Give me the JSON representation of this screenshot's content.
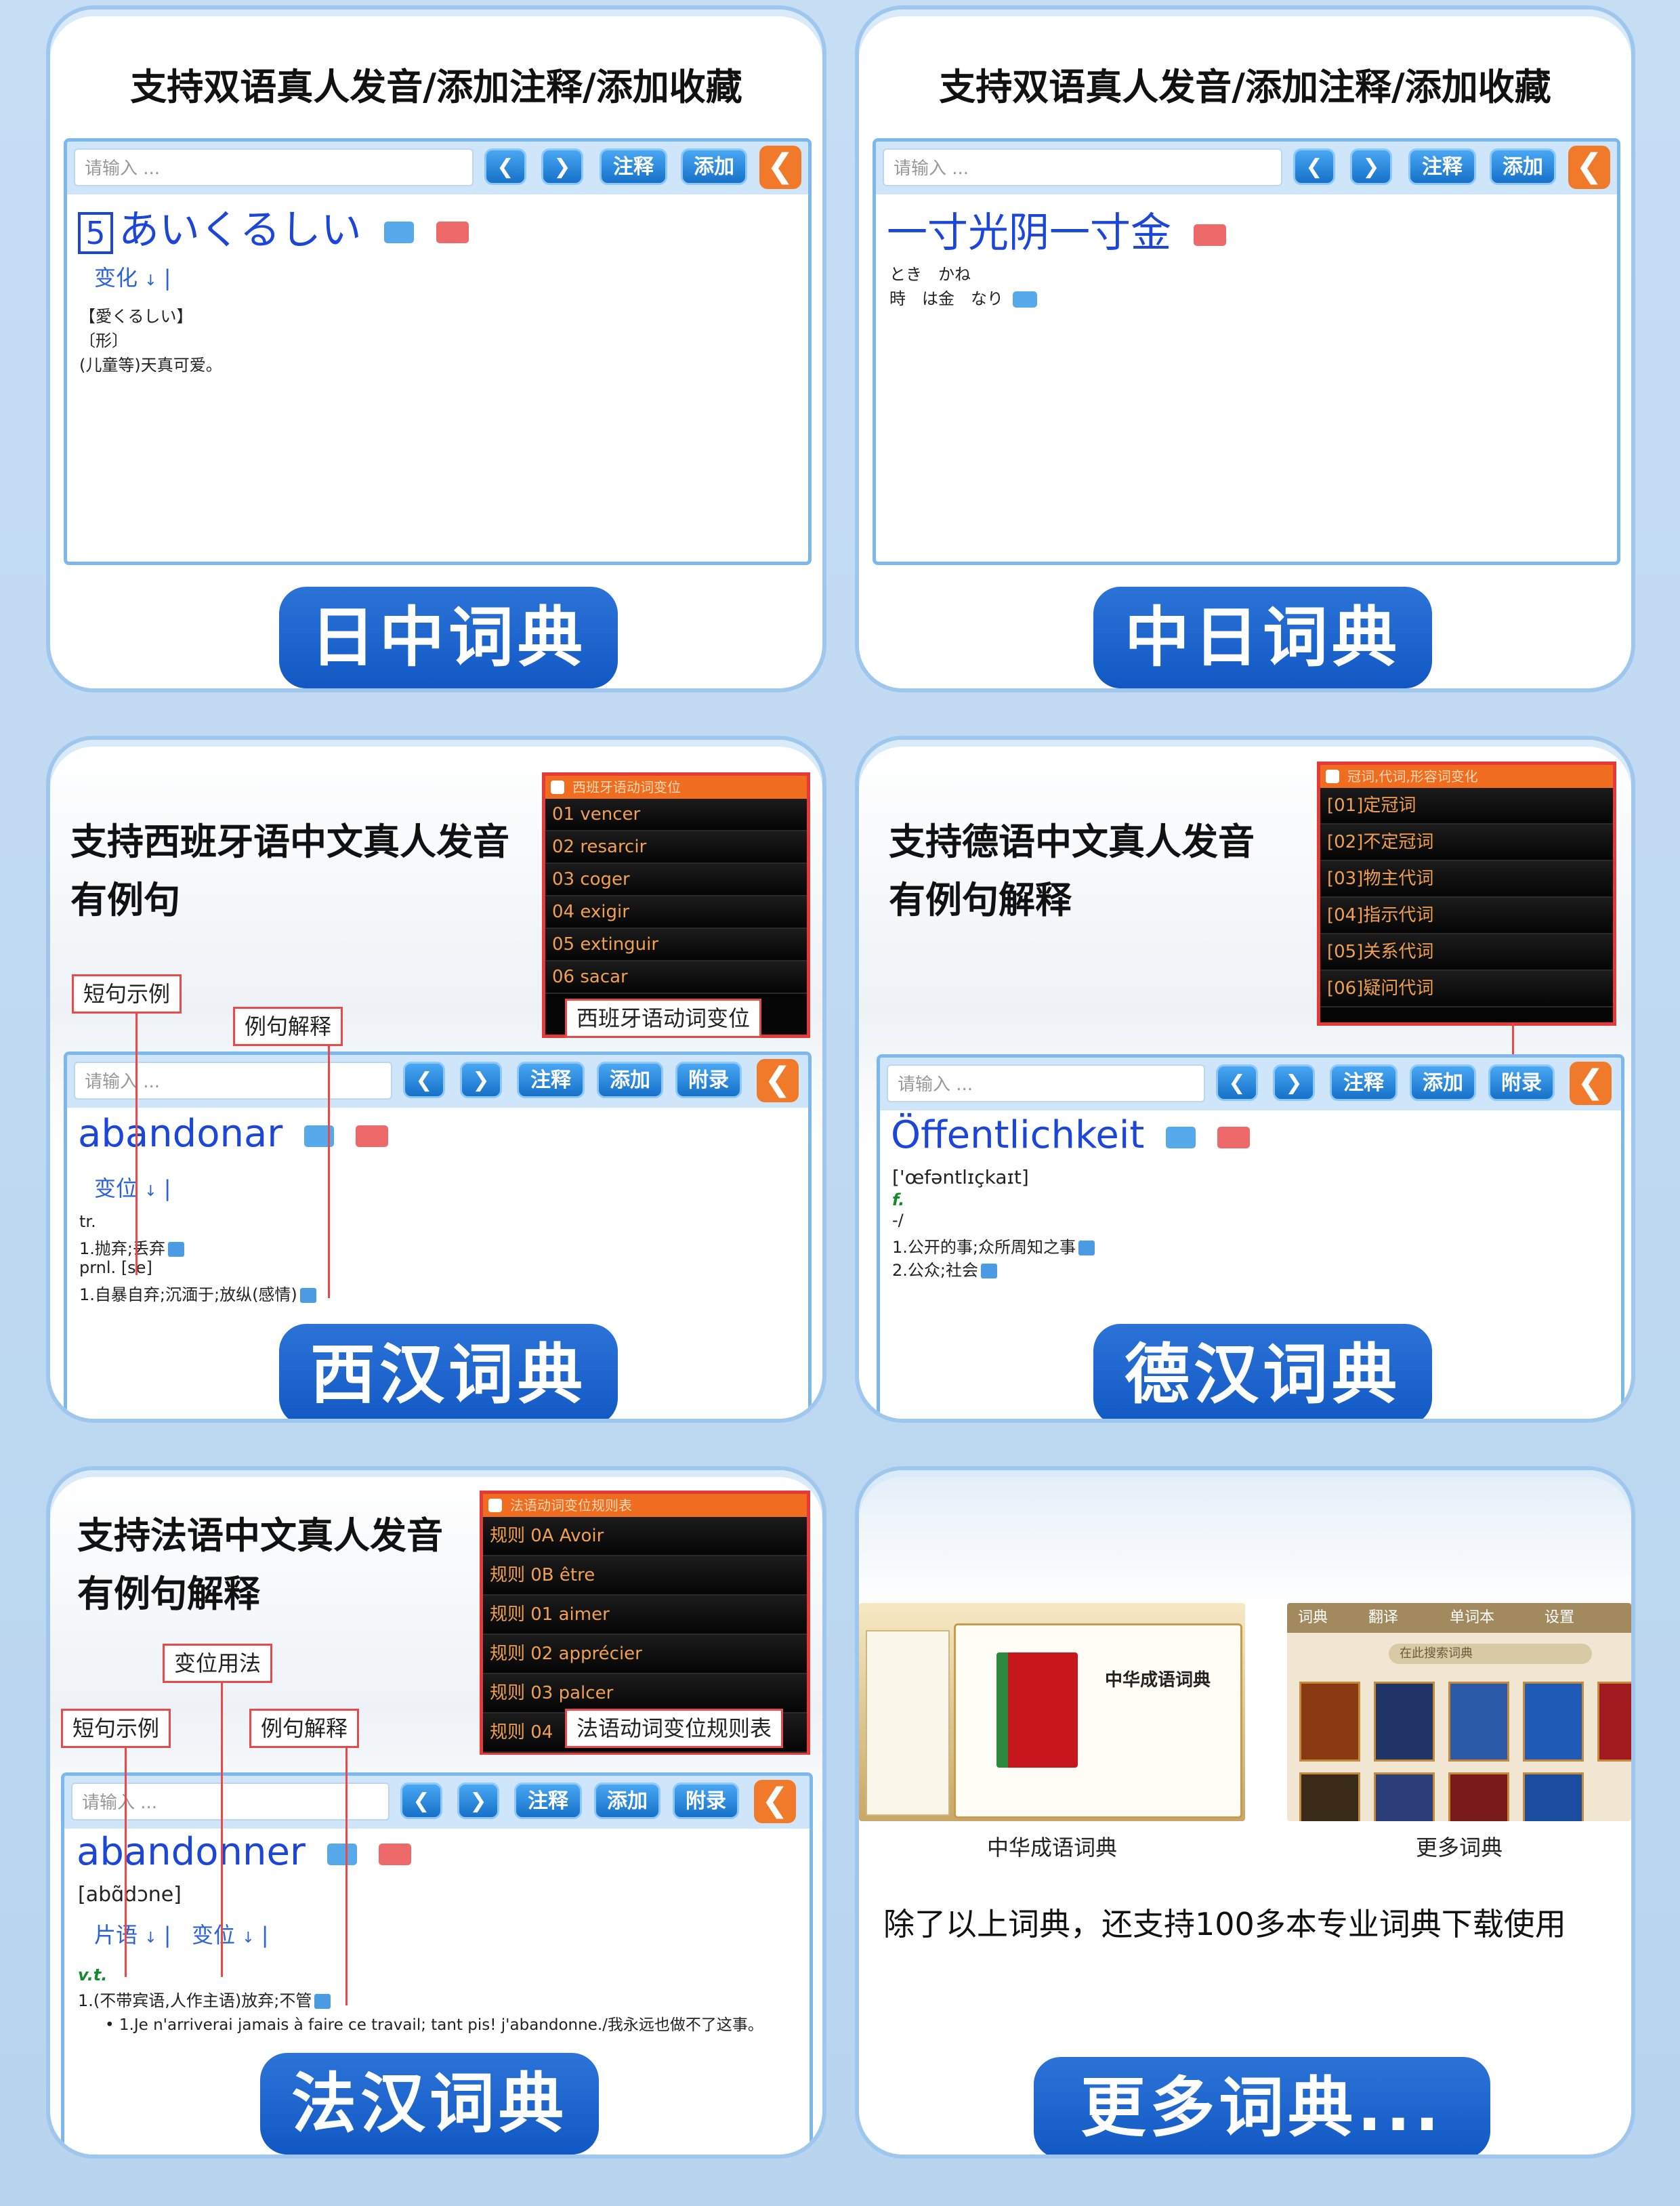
{
  "common": {
    "search_placeholder": "请输入 ...",
    "prev": "❮",
    "next": "❯",
    "note": "注释",
    "add": "添加",
    "appendix": "附录",
    "back": "❮"
  },
  "card1": {
    "heading": "支持双语真人发音/添加注释/添加收藏",
    "entry_num": "5",
    "word": "あいくるしい",
    "variation": "变化",
    "lines": [
      "【愛くるしい】",
      "〔形〕",
      "(儿童等)天真可爱。"
    ],
    "title": "日中词典"
  },
  "card2": {
    "heading": "支持双语真人发音/添加注释/添加收藏",
    "word": "一寸光阴一寸金",
    "furigana": "とき　かね",
    "line": "時　は金　なり",
    "title": "中日词典"
  },
  "card3": {
    "heading_line1": "支持西班牙语中文真人发音",
    "heading_line2": "有例句",
    "callout_short": "短句示例",
    "callout_example": "例句解释",
    "popup_header": "西班牙语动词变位",
    "popup_rows": [
      "01  vencer",
      "02  resarcir",
      "03  coger",
      "04  exigir",
      "05  extinguir",
      "06  sacar"
    ],
    "popup_caption": "西班牙语动词变位",
    "word": "abandonar",
    "variation": "变位",
    "lines": [
      "tr.",
      "1.抛弃;丢弃",
      "prnl. [se]",
      "1.自暴自弃;沉湎于;放纵(感情)"
    ],
    "title": "西汉词典"
  },
  "card4": {
    "heading_line1": "支持德语中文真人发音",
    "heading_line2": "有例句解释",
    "popup_header": "冠词,代词,形容词变化",
    "popup_rows": [
      "[01]定冠词",
      "[02]不定冠词",
      "[03]物主代词",
      "[04]指示代词",
      "[05]关系代词",
      "[06]疑问代词"
    ],
    "word": "Öffentlichkeit",
    "phonetic": "['œfəntlɪçkaɪt]",
    "gender": "f.",
    "dash": "-/",
    "lines": [
      "1.公开的事;众所周知之事",
      "2.公众;社会"
    ],
    "title": "德汉词典"
  },
  "card5": {
    "heading_line1": "支持法语中文真人发音",
    "heading_line2": "有例句解释",
    "callout_usage": "变位用法",
    "callout_short": "短句示例",
    "callout_example": "例句解释",
    "popup_header": "法语动词变位规则表",
    "popup_rows": [
      "规则 0A Avoir",
      "规则 0B être",
      "规则 01  aimer",
      "规则 02  apprécier",
      "规则 03  palcer",
      "规则 04"
    ],
    "popup_caption": "法语动词变位规则表",
    "word": "abandonner",
    "phonetic": "[abɑ̃dɔne]",
    "phrase": "片语",
    "variation": "变位",
    "pos": "v.t.",
    "line1": "1.(不带宾语,人作主语)放弃;不管",
    "example": "1.Je n'arriverai jamais à faire ce travail; tant pis! j'abandonne./我永远也做不了这事。",
    "title": "法汉词典"
  },
  "card6": {
    "thumb1_label": "中华成语词典",
    "book_title": "中华成语词典",
    "thumb2_label": "更多词典",
    "app_tabs": [
      "词典",
      "翻译",
      "单词本",
      "设置"
    ],
    "app_search": "在此搜索词典",
    "description": "除了以上词典，还支持100多本专业词典下载使用",
    "title": "更多词典..."
  }
}
